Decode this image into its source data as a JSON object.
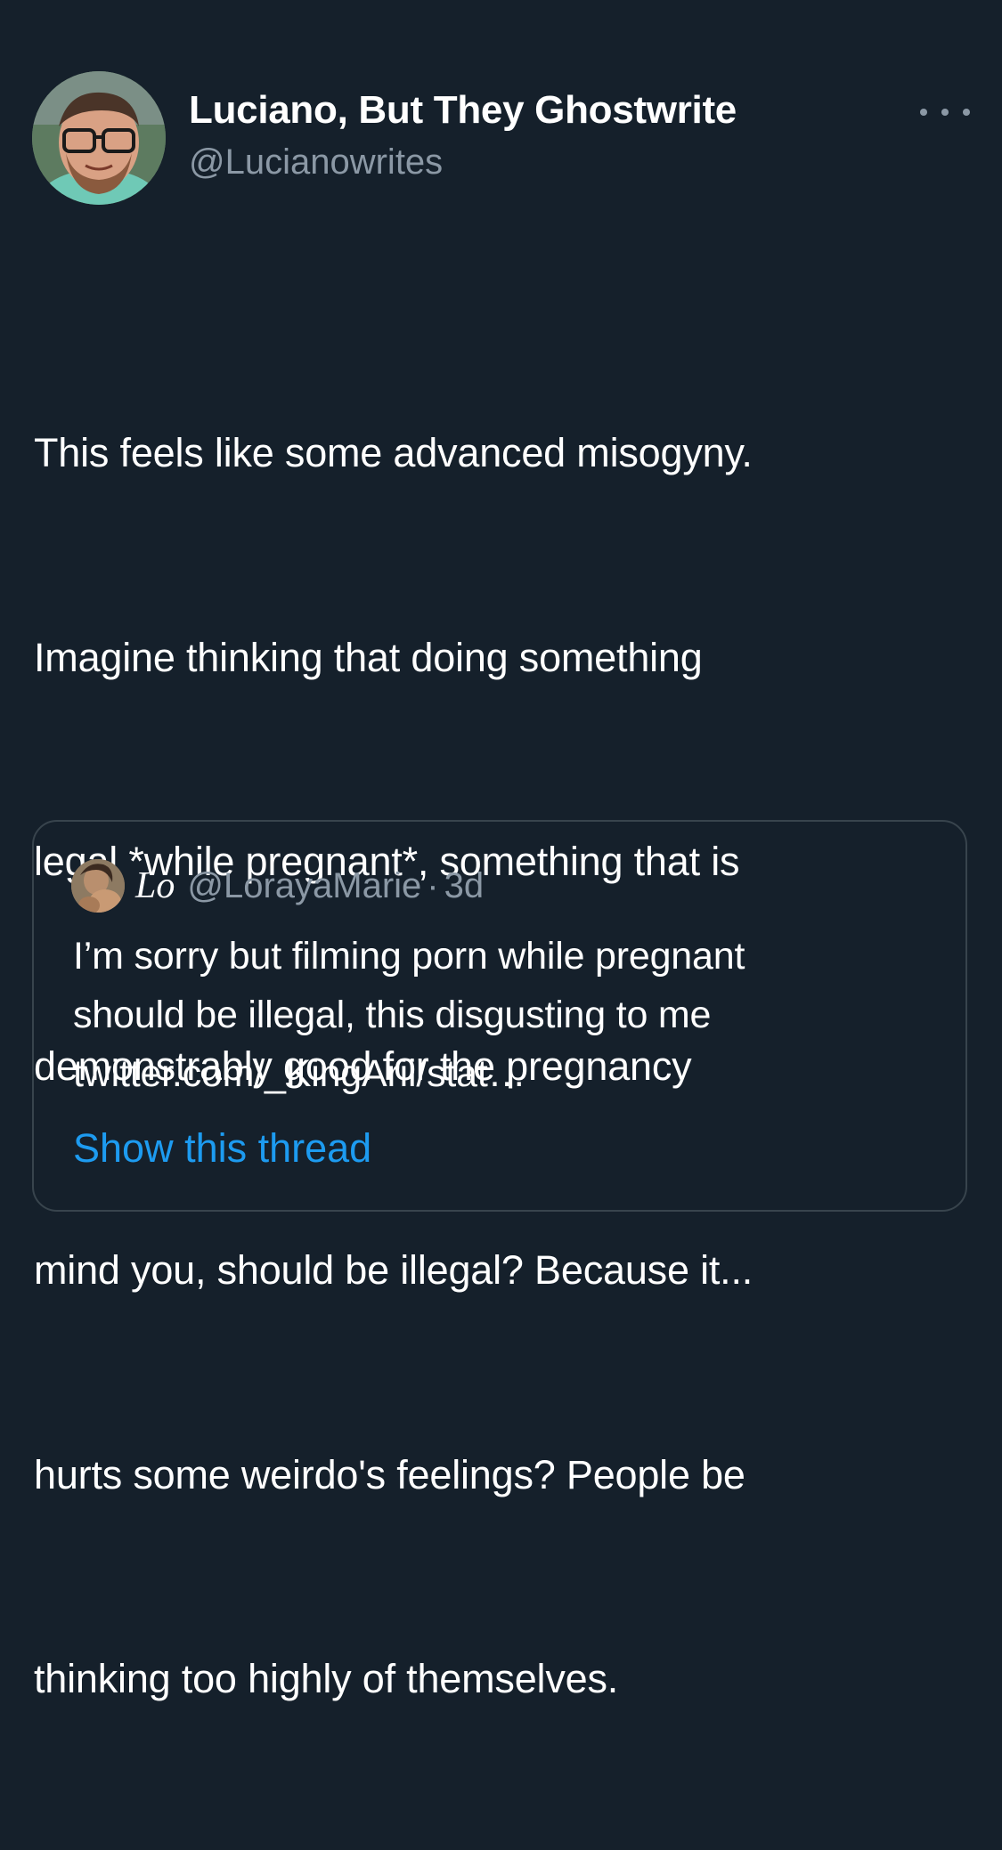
{
  "tweet": {
    "author": {
      "display_name": "Luciano, But They Ghostwrite",
      "handle": "@Lucianowrites"
    },
    "more_icon": "more-horizontal-icon",
    "text_lines": [
      "This feels like some advanced misogyny.",
      "Imagine thinking that doing something",
      "legal *while pregnant*, something that is",
      "demonstrably good for the pregnancy",
      "mind you, should be illegal? Because it...",
      "hurts some weirdo's feelings? People be",
      "thinking too highly of themselves."
    ]
  },
  "quote": {
    "name": "Lo",
    "handle": "@LorayaMarie",
    "separator": "·",
    "time": "3d",
    "text_lines": [
      "I’m sorry but filming porn while pregnant",
      "should be illegal, this disgusting to me",
      "twitter.com/_KingArii/stat…"
    ],
    "show_thread_label": "Show this thread"
  },
  "colors": {
    "background": "#15202b",
    "secondary_text": "#8b98a5",
    "link": "#1d9bf0",
    "border": "#38444d"
  }
}
